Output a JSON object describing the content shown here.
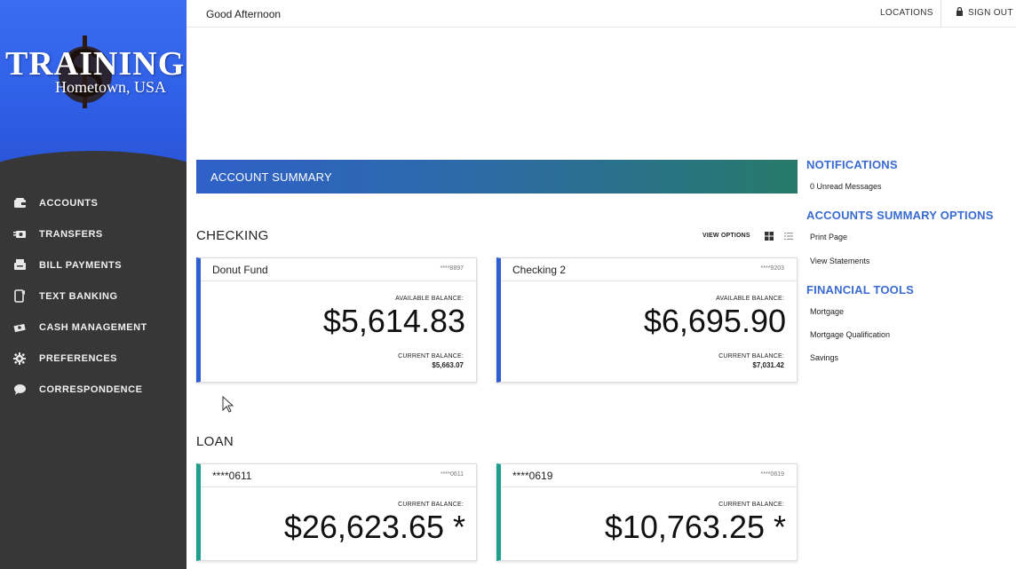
{
  "header": {
    "greeting": "Good Afternoon",
    "locations": "LOCATIONS",
    "sign_out": "SIGN OUT"
  },
  "logo": {
    "title": "TRAINING",
    "subtitle": "Hometown, USA"
  },
  "sidebar": {
    "items": [
      {
        "label": "ACCOUNTS",
        "icon": "wallet-icon"
      },
      {
        "label": "TRANSFERS",
        "icon": "transfer-icon"
      },
      {
        "label": "BILL PAYMENTS",
        "icon": "bill-icon"
      },
      {
        "label": "TEXT BANKING",
        "icon": "phone-icon"
      },
      {
        "label": "CASH MANAGEMENT",
        "icon": "cash-icon"
      },
      {
        "label": "PREFERENCES",
        "icon": "gear-icon"
      },
      {
        "label": "CORRESPONDENCE",
        "icon": "chat-icon"
      }
    ]
  },
  "main": {
    "banner": "ACCOUNT SUMMARY",
    "checking": {
      "title": "CHECKING",
      "view_options": "VIEW OPTIONS",
      "accounts": [
        {
          "name": "Donut Fund",
          "mask": "****8897",
          "available_label": "AVAILABLE BALANCE:",
          "available": "$5,614.83",
          "current_label": "CURRENT BALANCE:",
          "current": "$5,663.07"
        },
        {
          "name": "Checking 2",
          "mask": "****9203",
          "available_label": "AVAILABLE BALANCE:",
          "available": "$6,695.90",
          "current_label": "CURRENT BALANCE:",
          "current": "$7,031.42"
        }
      ]
    },
    "loan": {
      "title": "LOAN",
      "accounts": [
        {
          "name": "****0611",
          "mask": "****0611",
          "current_label": "CURRENT BALANCE:",
          "current": "$26,623.65 *"
        },
        {
          "name": "****0619",
          "mask": "****0619",
          "current_label": "CURRENT BALANCE:",
          "current": "$10,763.25 *"
        }
      ]
    }
  },
  "right": {
    "notifications": {
      "title": "NOTIFICATIONS",
      "unread": "0 Unread Messages"
    },
    "summary_options": {
      "title": "ACCOUNTS SUMMARY OPTIONS",
      "links": [
        "Print Page",
        "View Statements"
      ]
    },
    "financial_tools": {
      "title": "FINANCIAL TOOLS",
      "links": [
        "Mortgage",
        "Mortgage Qualification",
        "Savings"
      ]
    }
  },
  "colors": {
    "sidebar_bg": "#373737",
    "logo_blue": "#2f5fe6",
    "accent_blue": "#3a6bd0",
    "checking_border": "#2d5fd0",
    "loan_border": "#1f9e8e"
  }
}
